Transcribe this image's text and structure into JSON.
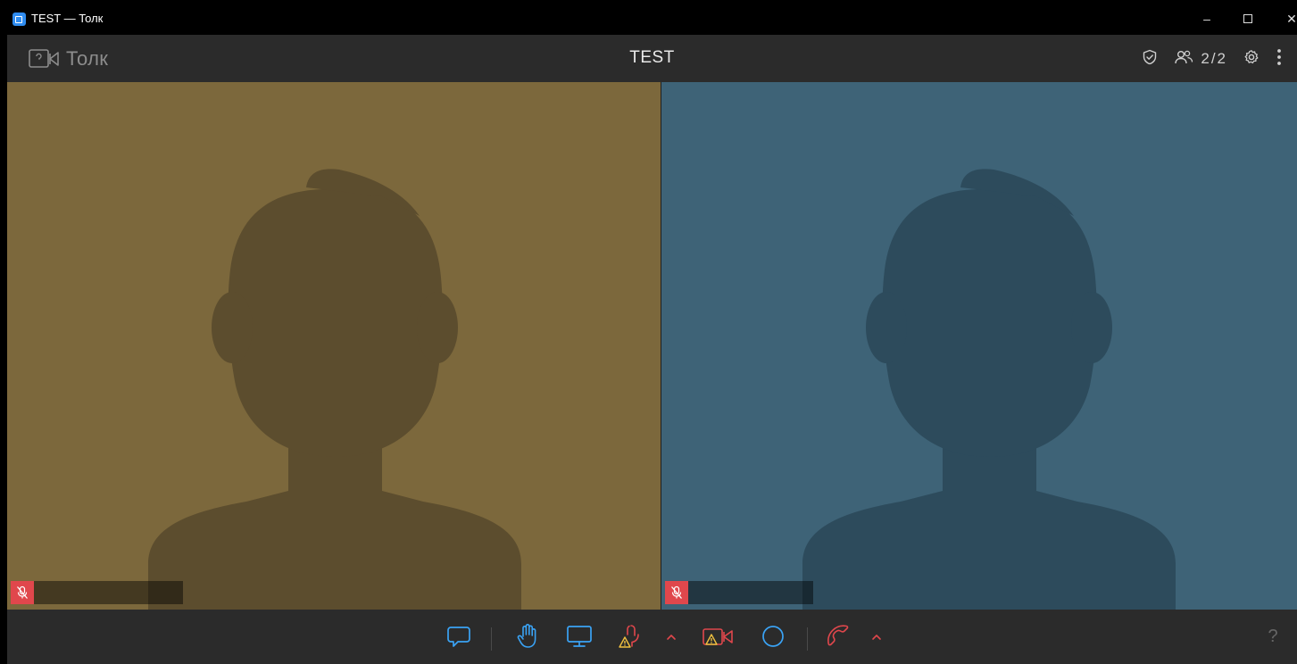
{
  "window": {
    "title": "TEST — Толк",
    "minimize_label": "–",
    "close_label": "✕"
  },
  "header": {
    "logo_text": "Толк",
    "meeting_title": "TEST",
    "participants_count": "2/2",
    "icons": [
      "shield-check-icon",
      "participants-icon",
      "settings-gear-icon",
      "more-vertical-icon"
    ]
  },
  "tiles": [
    {
      "background": "#7c683c",
      "silhouette": "#5c4d2e",
      "muted": true
    },
    {
      "background": "#3e6377",
      "silhouette": "#2d4b5c",
      "muted": true
    }
  ],
  "toolbar": {
    "buttons": [
      "chat-icon",
      "raise-hand-icon",
      "screen-share-icon",
      "microphone-warning-icon",
      "camera-warning-icon",
      "record-icon",
      "hang-up-icon"
    ],
    "help_label": "?"
  },
  "colors": {
    "accent_blue": "#3aa3f5",
    "danger_red": "#e0474c",
    "bar_bg": "#2b2b2b"
  }
}
